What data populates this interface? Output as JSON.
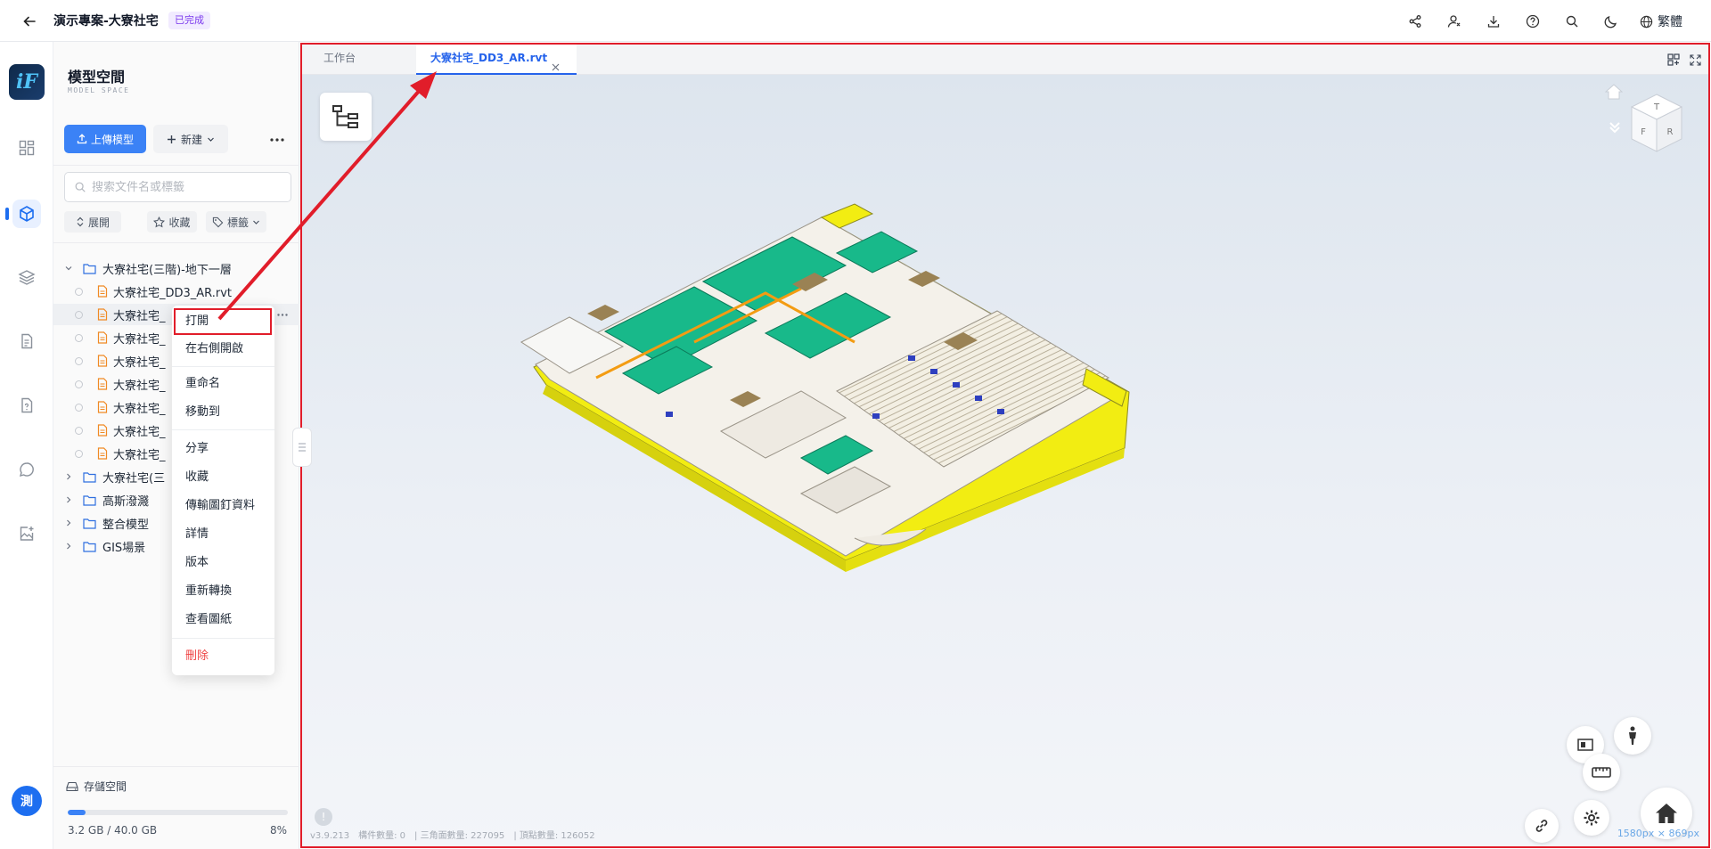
{
  "header": {
    "project_title": "演示專案-大寮社宅",
    "status": "已完成",
    "language": "繁體"
  },
  "rail": {
    "logo_text": "iF",
    "avatar_text": "測"
  },
  "panel": {
    "title": "模型空間",
    "subtitle": "MODEL SPACE",
    "upload_label": "上傳模型",
    "new_label": "新建",
    "search_placeholder": "搜索文件名或標籤",
    "filters": {
      "expand": "展開",
      "favorite": "收藏",
      "tags": "標籤"
    },
    "tree": [
      {
        "type": "folder",
        "label": "大寮社宅(三階)-地下一層",
        "expanded": true
      },
      {
        "type": "file",
        "label": "大寮社宅_DD3_AR.rvt"
      },
      {
        "type": "file",
        "label": "大寮社宅_"
      },
      {
        "type": "file",
        "label": "大寮社宅_"
      },
      {
        "type": "file",
        "label": "大寮社宅_"
      },
      {
        "type": "file",
        "label": "大寮社宅_"
      },
      {
        "type": "file",
        "label": "大寮社宅_"
      },
      {
        "type": "file",
        "label": "大寮社宅_"
      },
      {
        "type": "file",
        "label": "大寮社宅_"
      },
      {
        "type": "folder",
        "label": "大寮社宅(三",
        "expanded": false
      },
      {
        "type": "folder",
        "label": "高斯潑濺",
        "expanded": false
      },
      {
        "type": "folder",
        "label": "整合模型",
        "expanded": false
      },
      {
        "type": "folder",
        "label": "GIS場景",
        "expanded": false
      }
    ],
    "storage": {
      "label": "存儲空間",
      "used": "3.2 GB / 40.0 GB",
      "percent_text": "8%",
      "percent": 8
    }
  },
  "context_menu": {
    "items": [
      "打開",
      "在右側開啟",
      "重命名",
      "移動到",
      "分享",
      "收藏",
      "傳輸圖釘資料",
      "詳情",
      "版本",
      "重新轉換",
      "查看圖紙",
      "刪除"
    ]
  },
  "viewer": {
    "tabs": [
      {
        "label": "工作台",
        "active": false
      },
      {
        "label": "大寮社宅_DD3_AR.rvt",
        "active": true
      }
    ],
    "cube_faces": {
      "top": "T",
      "front": "F",
      "right": "R"
    },
    "stats": {
      "version": "v3.9.213",
      "components": "構件數量: 0",
      "triangles": "三角面數量: 227095",
      "vertices": "頂點數量: 126052"
    },
    "resolution": "1580px × 869px",
    "info_mark": "!"
  },
  "colors": {
    "accent": "#3b82f6",
    "annotation": "#e11d2a",
    "status_text": "#7c3aed",
    "danger": "#ef4444"
  }
}
